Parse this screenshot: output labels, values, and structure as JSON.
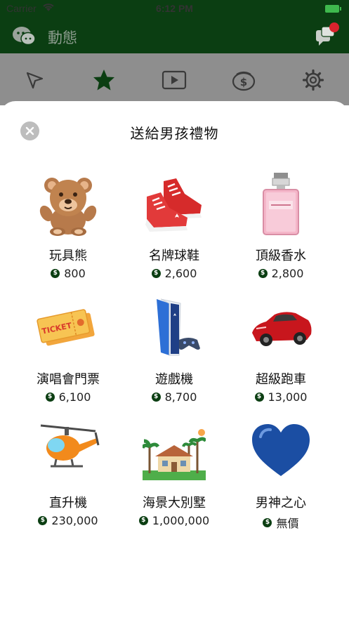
{
  "status_bar": {
    "carrier": "Carrier",
    "time": "6:12 PM"
  },
  "nav": {
    "title": "動態"
  },
  "tabs": [
    {
      "icon": "cursor-icon"
    },
    {
      "icon": "star-icon"
    },
    {
      "icon": "play-icon"
    },
    {
      "icon": "wallet-icon"
    },
    {
      "icon": "gear-icon"
    }
  ],
  "sheet": {
    "title": "送給男孩禮物",
    "gifts": [
      {
        "name": "玩具熊",
        "price": "800",
        "icon": "teddy-bear"
      },
      {
        "name": "名牌球鞋",
        "price": "2,600",
        "icon": "sneakers"
      },
      {
        "name": "頂級香水",
        "price": "2,800",
        "icon": "perfume"
      },
      {
        "name": "演唱會門票",
        "price": "6,100",
        "icon": "ticket"
      },
      {
        "name": "遊戲機",
        "price": "8,700",
        "icon": "game-console"
      },
      {
        "name": "超級跑車",
        "price": "13,000",
        "icon": "sports-car"
      },
      {
        "name": "直升機",
        "price": "230,000",
        "icon": "helicopter"
      },
      {
        "name": "海景大別墅",
        "price": "1,000,000",
        "icon": "villa"
      },
      {
        "name": "男神之心",
        "price": "無價",
        "icon": "blue-heart"
      }
    ],
    "ticket_text": "TICKET"
  },
  "colors": {
    "dark_green": "#0b3e12",
    "tab_gray": "#8e8e8e",
    "accent_red": "#d9232d"
  }
}
